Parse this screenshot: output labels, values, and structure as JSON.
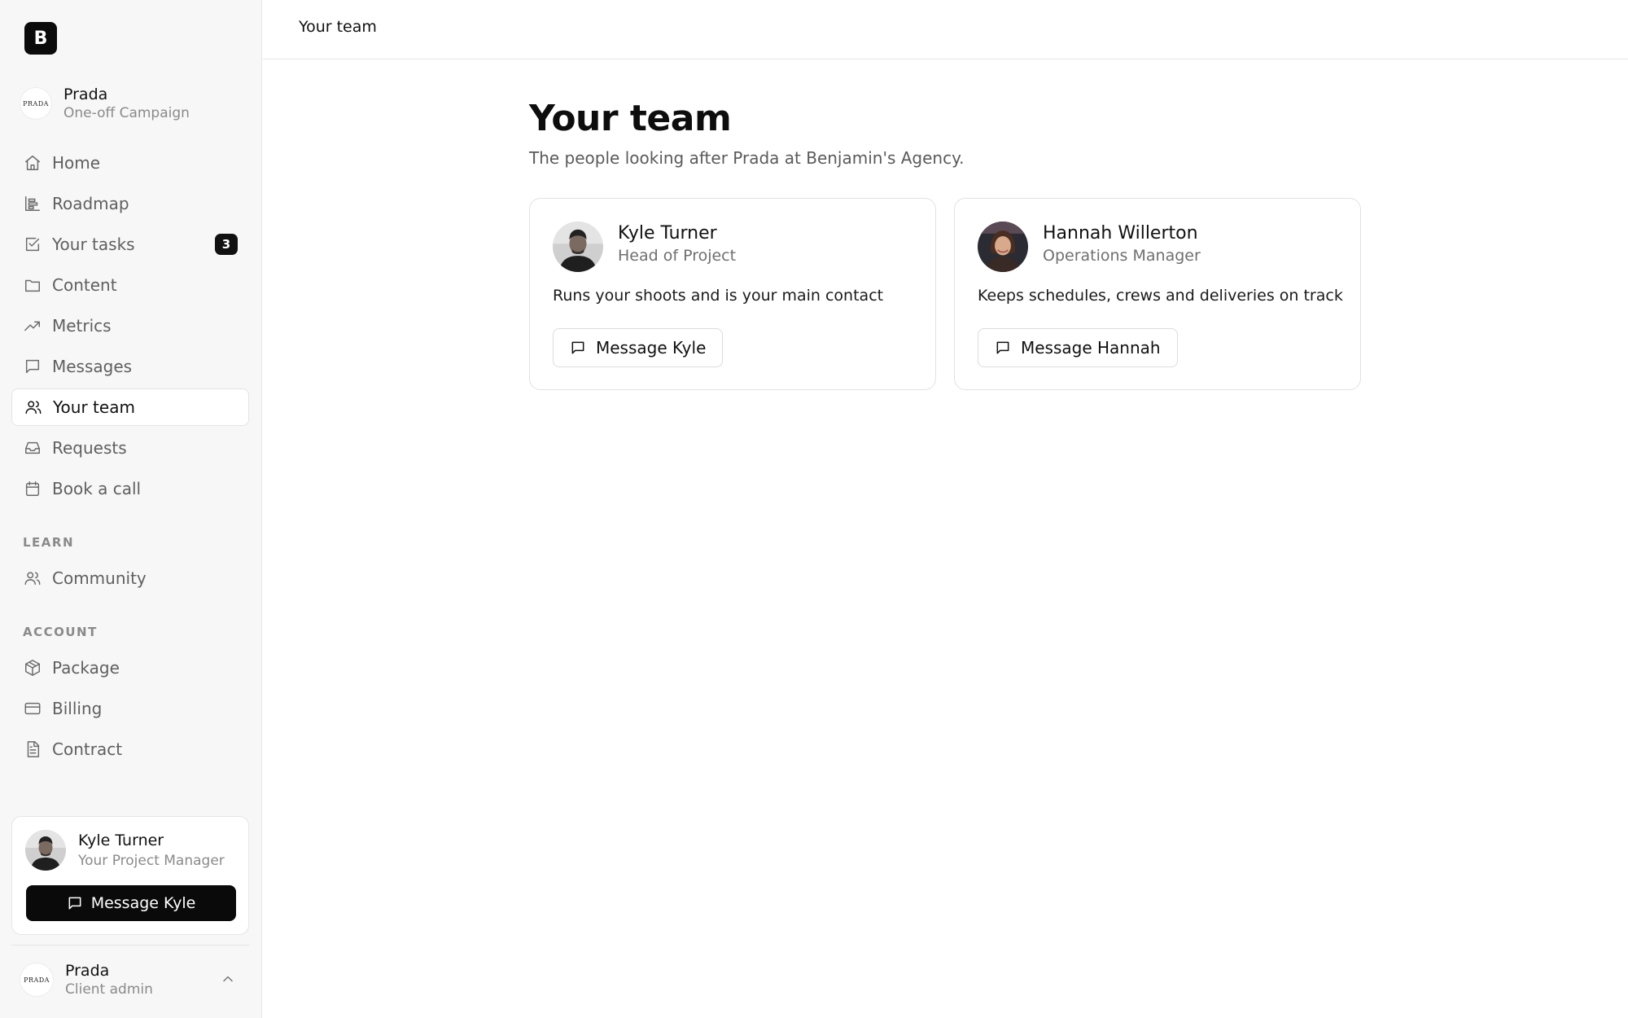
{
  "brand": {
    "logo_letter": "B"
  },
  "client": {
    "logo_text": "PRADA",
    "name": "Prada",
    "subtitle": "One-off Campaign"
  },
  "sidebar": {
    "items": [
      {
        "label": "Home",
        "icon": "home-icon"
      },
      {
        "label": "Roadmap",
        "icon": "roadmap-icon"
      },
      {
        "label": "Your tasks",
        "icon": "tasks-icon",
        "badge": "3"
      },
      {
        "label": "Content",
        "icon": "folder-icon"
      },
      {
        "label": "Metrics",
        "icon": "trending-up-icon"
      },
      {
        "label": "Messages",
        "icon": "message-icon"
      },
      {
        "label": "Your team",
        "icon": "users-icon",
        "active": true
      },
      {
        "label": "Requests",
        "icon": "inbox-icon"
      },
      {
        "label": "Book a call",
        "icon": "calendar-icon"
      }
    ],
    "learn_section": {
      "label": "LEARN",
      "items": [
        {
          "label": "Community",
          "icon": "users-icon"
        }
      ]
    },
    "account_section": {
      "label": "ACCOUNT",
      "items": [
        {
          "label": "Package",
          "icon": "package-icon"
        },
        {
          "label": "Billing",
          "icon": "credit-card-icon"
        },
        {
          "label": "Contract",
          "icon": "document-icon"
        }
      ]
    },
    "project_manager": {
      "name": "Kyle Turner",
      "role": "Your Project Manager",
      "button_label": "Message Kyle"
    },
    "account": {
      "logo_text": "PRADA",
      "name": "Prada",
      "role": "Client admin"
    }
  },
  "header": {
    "breadcrumb": "Your team"
  },
  "main": {
    "title": "Your team",
    "subtitle": "The people looking after Prada at Benjamin's Agency.",
    "members": [
      {
        "name": "Kyle Turner",
        "role": "Head of Project",
        "description": "Runs your shoots and is your main contact",
        "button_label": "Message Kyle"
      },
      {
        "name": "Hannah Willerton",
        "role": "Operations Manager",
        "description": "Keeps schedules, crews and deliveries on track",
        "button_label": "Message Hannah"
      }
    ]
  },
  "colors": {
    "accent": "#0a0a0a",
    "sidebar_bg": "#f7f7f7",
    "border": "#e4e4e4",
    "muted_text": "#8a8a8a"
  }
}
